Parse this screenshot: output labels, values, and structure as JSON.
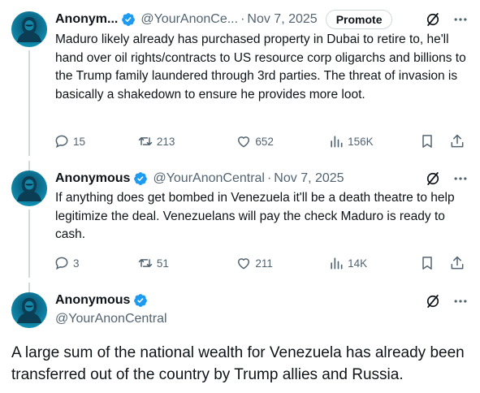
{
  "tweets": [
    {
      "name": "Anonym...",
      "handle": "@YourAnonCe...",
      "date": "Nov 7, 2025",
      "promote_label": "Promote",
      "text": "Maduro likely already has purchased property in Dubai to retire to, he'll hand over oil rights/contracts to US resource corp oligarchs and billions to the Trump family laundered through 3rd parties. The threat of invasion is basically a shakedown to ensure he provides more loot.",
      "replies": "15",
      "retweets": "213",
      "likes": "652",
      "views": "156K"
    },
    {
      "name": "Anonymous",
      "handle": "@YourAnonCentral",
      "date": "Nov 7, 2025",
      "text": "If anything does get bombed in Venezuela it'll be a death theatre to help legitimize the deal. Venezuelans will pay the check Maduro is ready to cash.",
      "replies": "3",
      "retweets": "51",
      "likes": "211",
      "views": "14K"
    },
    {
      "name": "Anonymous",
      "handle": "@YourAnonCentral",
      "text": "A large sum of the national wealth for Venezuela has already been transferred out of the country by Trump allies and Russia."
    }
  ],
  "separator": "·",
  "colors": {
    "verified": "#1d9bf0",
    "muted": "#536471",
    "text": "#0f1419",
    "thread_line": "#cfd9de"
  },
  "icons": [
    "verified-badge-icon",
    "grok-icon",
    "more-icon",
    "reply-icon",
    "retweet-icon",
    "like-icon",
    "views-icon",
    "bookmark-icon",
    "share-icon"
  ]
}
